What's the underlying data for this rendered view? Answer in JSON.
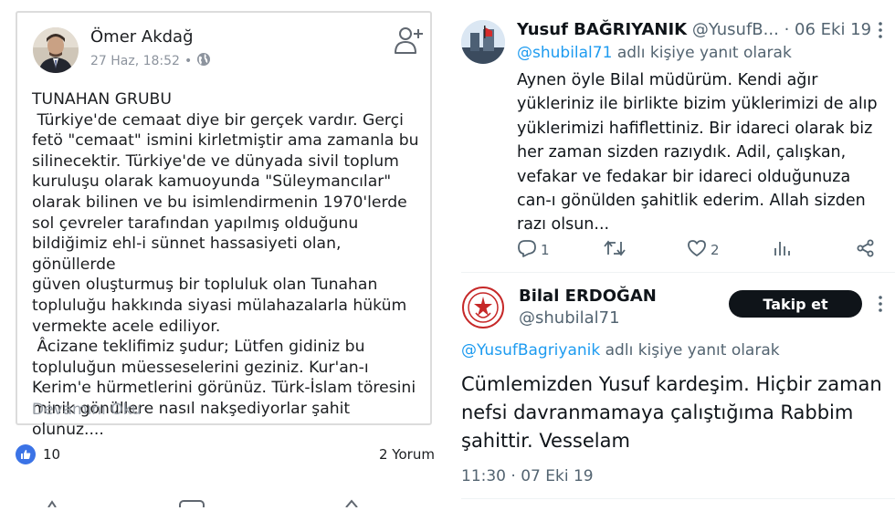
{
  "fb_post": {
    "author": "Ömer Akdağ",
    "date": "27 Haz, 18:52",
    "date_separator": "•",
    "body": "TUNAHAN GRUBU\n Türkiye'de cemaat diye bir gerçek vardır. Gerçi\nfetö \"cemaat\" ismini kirletmiştir ama zamanla bu\nsilinecektir. Türkiye'de ve dünyada sivil toplum\nkuruluşu olarak kamuoyunda \"Süleymancılar\"\nolarak bilinen ve bu isimlendirmenin 1970'lerde\nsol çevreler tarafından yapılmış olduğunu\nbildiğimiz ehl-i sünnet hassasiyeti olan, gönüllerde\ngüven oluşturmuş bir topluluk olan Tunahan\ntopluluğu hakkında siyasi mülahazalarla hüküm\nvermekte acele ediliyor.\n Âcizane teklifimiz şudur; Lütfen gidiniz bu\ntopluluğun müesseselerini geziniz. Kur'an-ı\nKerim'e hürmetlerini görünüz. Türk-İslam töresini\nminik gönüllere nasıl nakşediyorlar şahit olunuz....",
    "see_more": "Devamını Oku",
    "like_count": "10",
    "comment_count": "2 Yorum",
    "icons": [
      "globe-icon",
      "add-friend-icon",
      "like-icon"
    ],
    "colors": {
      "like_blue": "#3b73e6",
      "muted": "#8d949e"
    }
  },
  "tweet1": {
    "name": "Yusuf BAĞRIYANIK",
    "handle": "@YusufB...",
    "dot": "·",
    "date": "06 Eki 19",
    "reply_to_handle": "@shubilal71",
    "reply_to_suffix": " adlı kişiye yanıt olarak",
    "body": "Aynen öyle Bilal müdürüm. Kendi ağır\nyükleriniz ile birlikte bizim yüklerimizi de alıp\nyüklerimizi hafiflettiniz. Bir idareci olarak biz\nher zaman sizden razıydık. Adil, çalışkan,\nvefakar ve fedakar bir idareci olduğunuza\ncan-ı gönülden şahitlik ederim. Allah sizden\nrazı olsun...",
    "reply_count": "1",
    "retweet_count": "",
    "like_count": "2"
  },
  "tweet2": {
    "name": "Bilal ERDOĞAN",
    "handle": "@shubilal71",
    "follow_label": "Takip et",
    "reply_to_handle": "@YusufBagriyanik",
    "reply_to_suffix": " adlı kişiye yanıt olarak",
    "body": "Cümlemizden Yusuf kardeşim. Hiçbir zaman\nnefsi davranmamaya çalıştığıma Rabbim\nşahittir. Vesselam",
    "timestamp": "11:30 · 07 Eki 19"
  },
  "colors": {
    "twitter_link": "#1d9bf0",
    "twitter_muted": "#536471",
    "text": "#0f1419"
  }
}
